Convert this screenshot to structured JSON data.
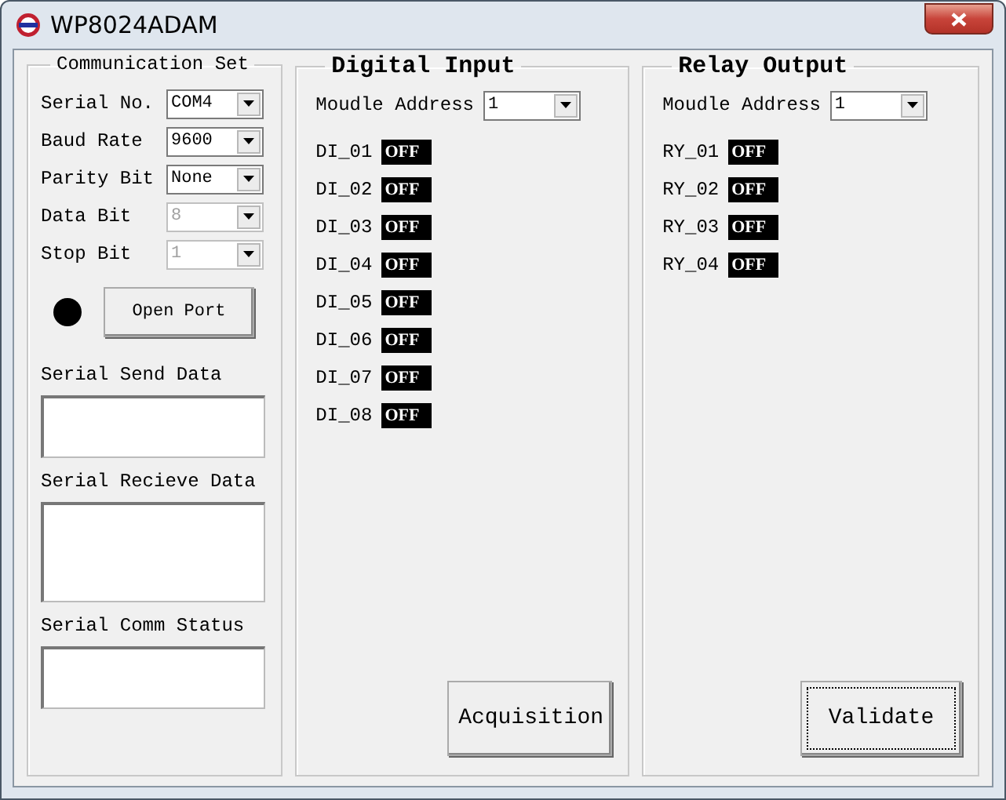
{
  "window": {
    "title": "WP8024ADAM"
  },
  "communication": {
    "legend": "Communication Set",
    "fields": [
      {
        "label": "Serial No.",
        "value": "COM4",
        "disabled": false
      },
      {
        "label": "Baud Rate",
        "value": "9600",
        "disabled": false
      },
      {
        "label": "Parity Bit",
        "value": "None",
        "disabled": false
      },
      {
        "label": "Data Bit",
        "value": "8",
        "disabled": true
      },
      {
        "label": "Stop Bit",
        "value": "1",
        "disabled": true
      }
    ],
    "port_open": false,
    "open_button": "Open Port",
    "boxes": [
      {
        "label": "Serial Send Data",
        "kind": "short"
      },
      {
        "label": "Serial Recieve Data",
        "kind": "tall"
      },
      {
        "label": "Serial Comm Status",
        "kind": "short"
      }
    ]
  },
  "digital_input": {
    "legend": "Digital Input",
    "address_label": "Moudle Address",
    "address": "1",
    "channels": [
      {
        "name": "DI_01",
        "state": "OFF"
      },
      {
        "name": "DI_02",
        "state": "OFF"
      },
      {
        "name": "DI_03",
        "state": "OFF"
      },
      {
        "name": "DI_04",
        "state": "OFF"
      },
      {
        "name": "DI_05",
        "state": "OFF"
      },
      {
        "name": "DI_06",
        "state": "OFF"
      },
      {
        "name": "DI_07",
        "state": "OFF"
      },
      {
        "name": "DI_08",
        "state": "OFF"
      }
    ],
    "button": {
      "label": "Acquisition",
      "focused": false
    }
  },
  "relay_output": {
    "legend": "Relay Output",
    "address_label": "Moudle Address",
    "address": "1",
    "channels": [
      {
        "name": "RY_01",
        "state": "OFF"
      },
      {
        "name": "RY_02",
        "state": "OFF"
      },
      {
        "name": "RY_03",
        "state": "OFF"
      },
      {
        "name": "RY_04",
        "state": "OFF"
      }
    ],
    "button": {
      "label": "Validate",
      "focused": true
    }
  }
}
